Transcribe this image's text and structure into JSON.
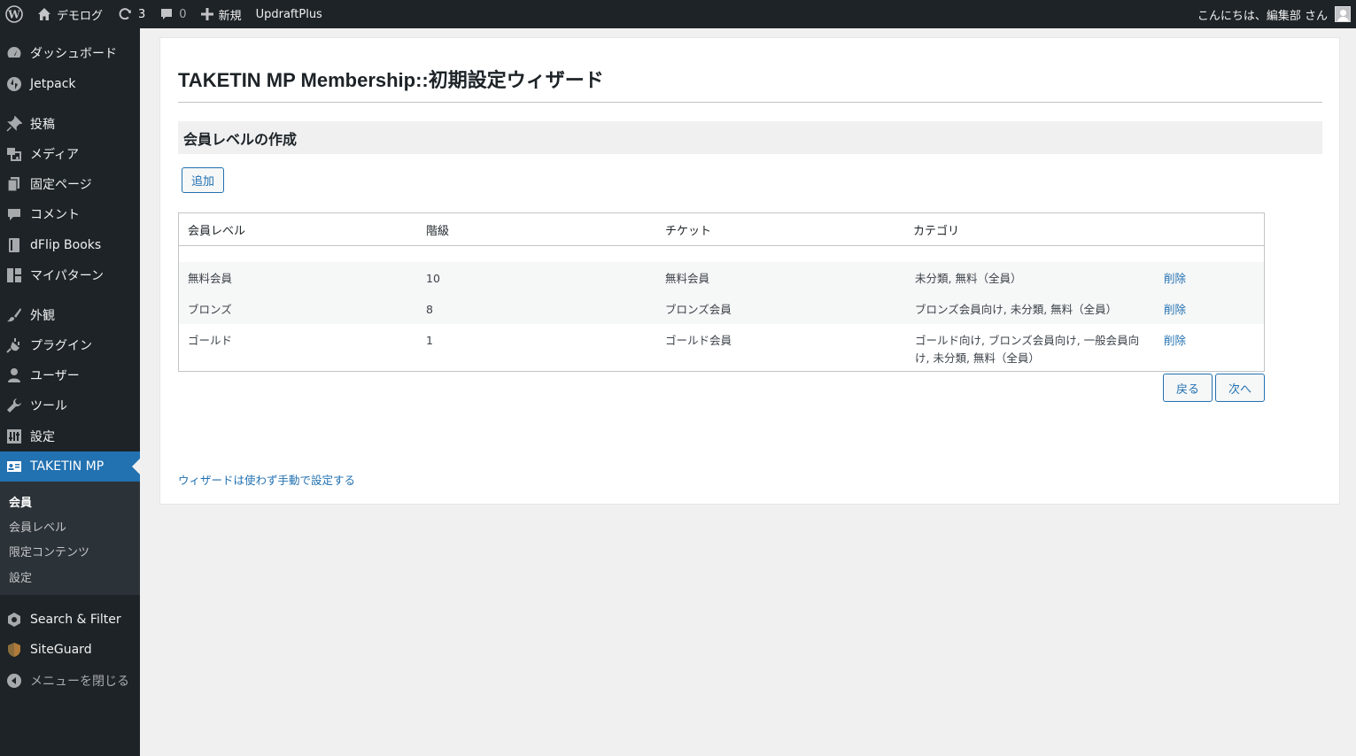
{
  "adminbar": {
    "site_name": "デモログ",
    "updates_count": "3",
    "comments_count": "0",
    "new_label": "新規",
    "plugin_label": "UpdraftPlus",
    "greeting": "こんにちは、編集部 さん"
  },
  "sidebar": {
    "items": [
      {
        "label": "ダッシュボード",
        "icon": "dashboard-icon"
      },
      {
        "label": "Jetpack",
        "icon": "jetpack-icon"
      },
      {
        "label": "投稿",
        "icon": "pin-icon"
      },
      {
        "label": "メディア",
        "icon": "media-icon"
      },
      {
        "label": "固定ページ",
        "icon": "page-icon"
      },
      {
        "label": "コメント",
        "icon": "comment-icon"
      },
      {
        "label": "dFlip Books",
        "icon": "book-icon"
      },
      {
        "label": "マイパターン",
        "icon": "pattern-icon"
      },
      {
        "label": "外観",
        "icon": "brush-icon"
      },
      {
        "label": "プラグイン",
        "icon": "plugin-icon"
      },
      {
        "label": "ユーザー",
        "icon": "user-icon"
      },
      {
        "label": "ツール",
        "icon": "wrench-icon"
      },
      {
        "label": "設定",
        "icon": "settings-icon"
      },
      {
        "label": "TAKETIN MP",
        "icon": "id-card-icon"
      },
      {
        "label": "Search & Filter",
        "icon": "hexagon-icon"
      },
      {
        "label": "SiteGuard",
        "icon": "shield-icon"
      },
      {
        "label": "メニューを閉じる",
        "icon": "collapse-icon"
      }
    ],
    "submenu": [
      "会員",
      "会員レベル",
      "限定コンテンツ",
      "設定"
    ]
  },
  "main": {
    "title": "TAKETIN MP Membership::初期設定ウィザード",
    "section_title": "会員レベルの作成",
    "add_button": "追加",
    "columns": [
      "会員レベル",
      "階級",
      "チケット",
      "カテゴリ"
    ],
    "rows": [
      {
        "level": "無料会員",
        "rank": "10",
        "ticket": "無料会員",
        "category": "未分類, 無料（全員）",
        "action": "削除"
      },
      {
        "level": "ブロンズ",
        "rank": "8",
        "ticket": "ブロンズ会員",
        "category": "ブロンズ会員向け, 未分類, 無料（全員）",
        "action": "削除"
      },
      {
        "level": "ゴールド",
        "rank": "1",
        "ticket": "ゴールド会員",
        "category": "ゴールド向け, ブロンズ会員向け, 一般会員向け, 未分類, 無料（全員）",
        "action": "削除"
      }
    ],
    "back_button": "戻る",
    "next_button": "次へ",
    "manual_link": "ウィザードは使わず手動で設定する"
  },
  "colors": {
    "admin_dark": "#1d2327",
    "accent": "#2271b1",
    "background": "#f0f0f1"
  }
}
